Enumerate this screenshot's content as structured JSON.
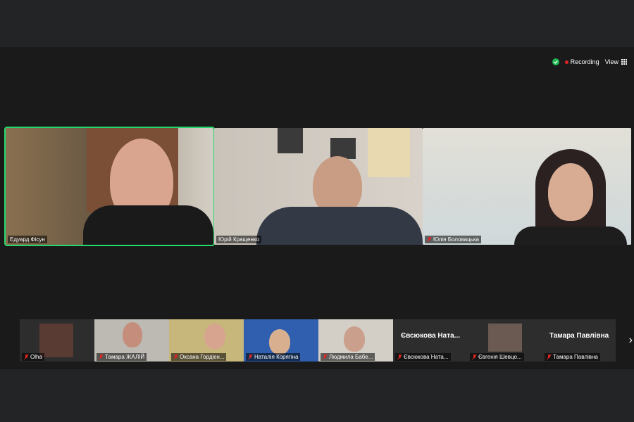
{
  "status": {
    "recording_label": "Recording",
    "view_label": "View"
  },
  "speakers": [
    {
      "name": "Едуард Фісун",
      "muted": false
    },
    {
      "name": "Юрій Кращенко",
      "muted": false
    },
    {
      "name": "Юлія Боловацька",
      "muted": true
    }
  ],
  "thumbnails": [
    {
      "name": "Olha",
      "muted": true
    },
    {
      "name": "Тамара ЖАЛІЙ",
      "muted": true
    },
    {
      "name": "Оксана Гордієн...",
      "muted": true
    },
    {
      "name": "Наталія Корягіна",
      "muted": true
    },
    {
      "name": "Людмила Бабе...",
      "muted": true
    },
    {
      "name": "Євсюкова Ната...",
      "muted": true,
      "card": "Євсюкова  Ната..."
    },
    {
      "name": "Євгенія Шевцо...",
      "muted": true
    },
    {
      "name": "Тамара Павлівна",
      "muted": true,
      "card": "Тамара Павлівна"
    }
  ],
  "colors": {
    "active_speaker": "#23d96b",
    "mic_muted": "#e02424",
    "secure": "#1fb851"
  }
}
